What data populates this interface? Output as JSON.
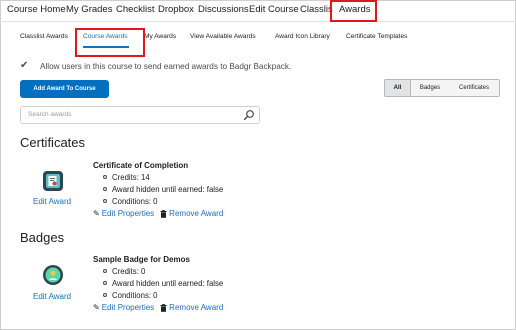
{
  "topnav": {
    "items": [
      "Course Home",
      "My Grades",
      "Checklist",
      "Dropbox",
      "Discussions",
      "Edit Course",
      "Classlis",
      "Awards"
    ]
  },
  "subtabs": {
    "items": [
      "Classlist Awards",
      "Course Awards",
      "My Awards",
      "View Available Awards",
      "Award Icon Library",
      "Certificate Templates"
    ]
  },
  "settings": {
    "badgr_label": "Allow users in this course to send earned awards to Badgr Backpack."
  },
  "toolbar": {
    "add_label": "Add Award To Course",
    "filters": [
      "All",
      "Badges",
      "Certificates"
    ]
  },
  "search": {
    "placeholder": "Search awards"
  },
  "certificates": {
    "heading": "Certificates",
    "edit_label": "Edit Award",
    "name": "Certificate of Completion",
    "details": [
      "Credits: 14",
      "Award hidden until earned: false",
      "Conditions: 0"
    ],
    "edit_properties": "Edit Properties",
    "remove": "Remove Award"
  },
  "badges": {
    "heading": "Badges",
    "edit_label": "Edit Award",
    "name": "Sample Badge for Demos",
    "details": [
      "Credits: 0",
      "Award hidden until earned: false",
      "Conditions: 0"
    ],
    "edit_properties": "Edit Properties",
    "remove": "Remove Award"
  },
  "colors": {
    "accent": "#006fbf",
    "link": "#1a6fbd",
    "highlight": "#e0171b"
  }
}
